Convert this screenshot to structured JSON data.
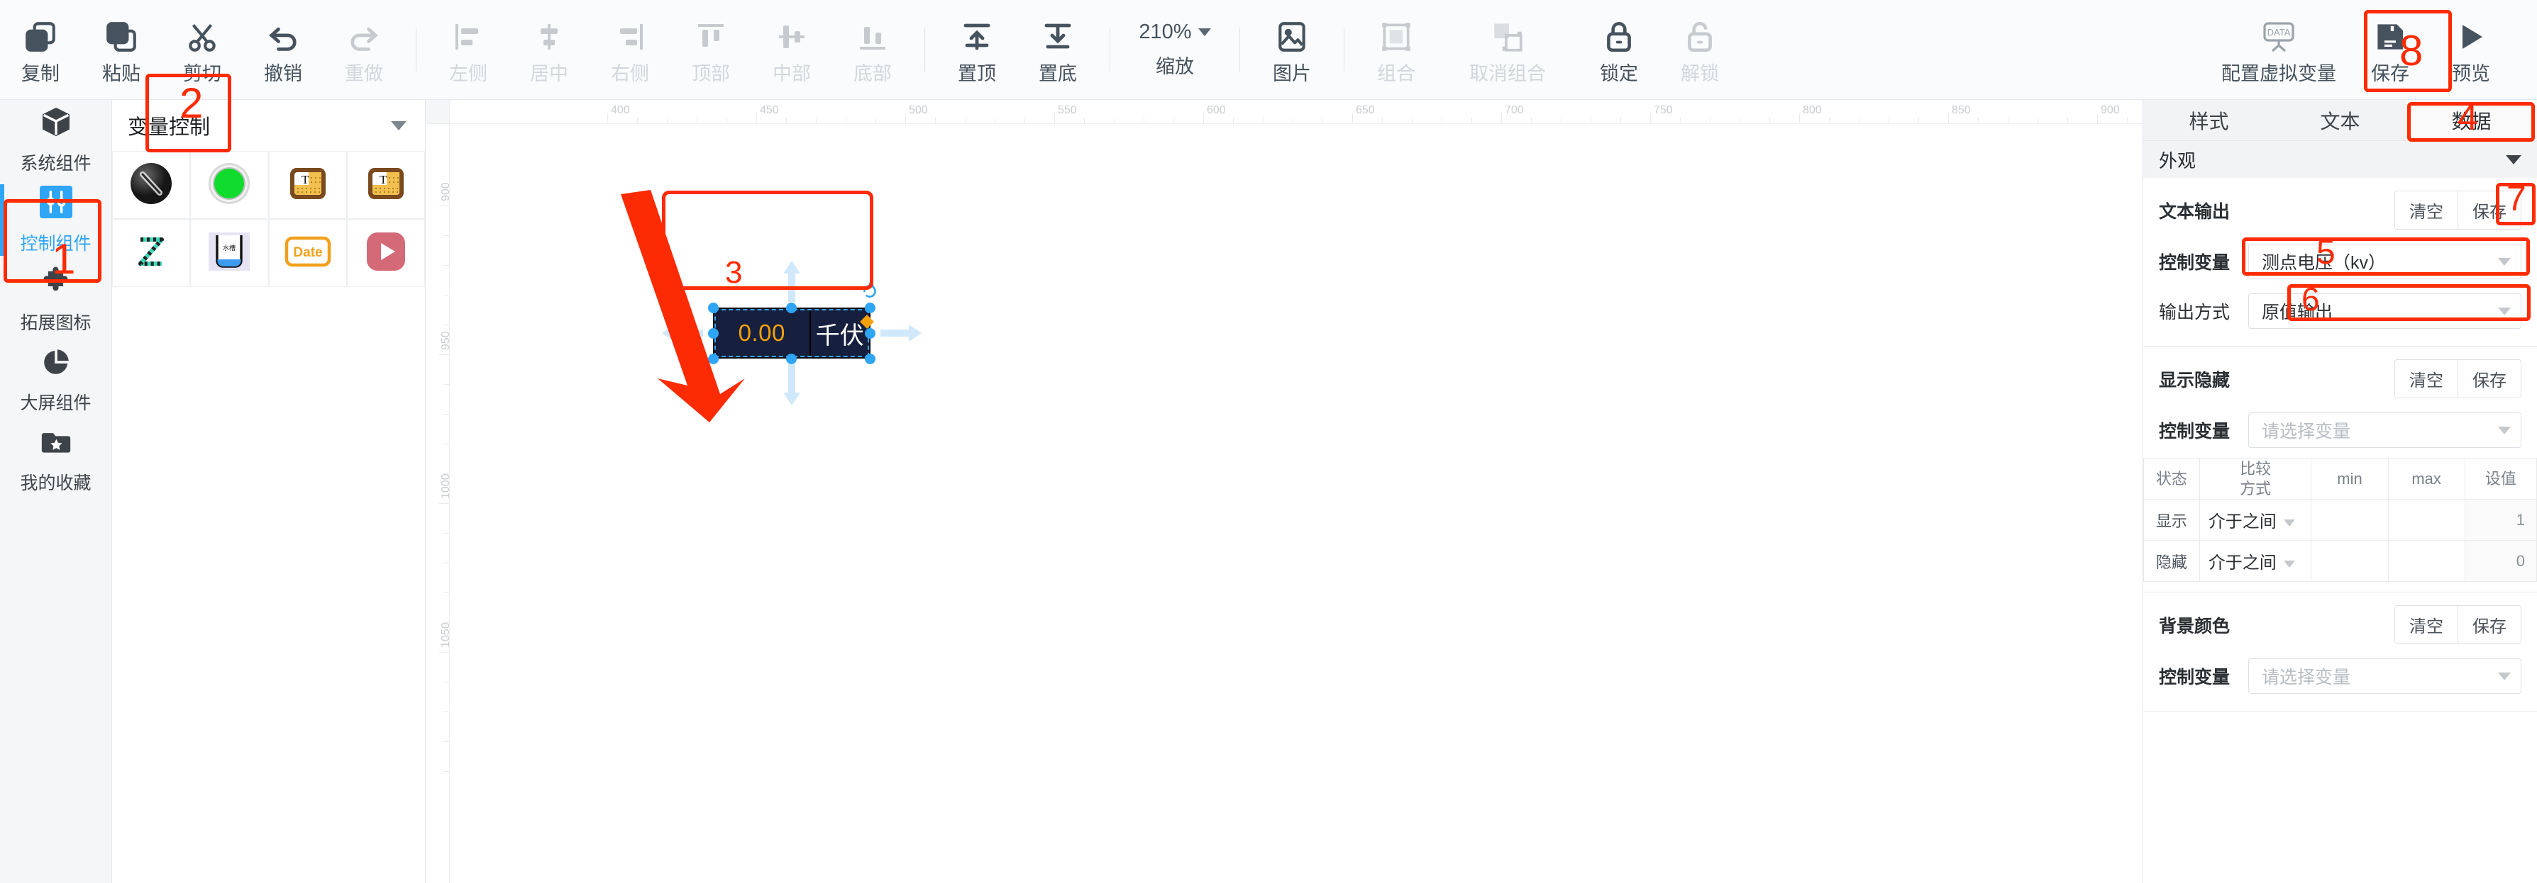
{
  "toolbar": {
    "groups": [
      {
        "items": [
          {
            "label": "复制",
            "icon": "copy-icon",
            "enabled": true
          },
          {
            "label": "粘贴",
            "icon": "paste-icon",
            "enabled": true
          },
          {
            "label": "剪切",
            "icon": "cut-icon",
            "enabled": true
          },
          {
            "label": "撤销",
            "icon": "undo-icon",
            "enabled": true
          },
          {
            "label": "重做",
            "icon": "redo-icon",
            "enabled": false
          }
        ]
      },
      {
        "items": [
          {
            "label": "左侧",
            "icon": "align-left-icon",
            "enabled": false
          },
          {
            "label": "居中",
            "icon": "align-center-icon",
            "enabled": false
          },
          {
            "label": "右侧",
            "icon": "align-right-icon",
            "enabled": false
          },
          {
            "label": "顶部",
            "icon": "align-top-icon",
            "enabled": false
          },
          {
            "label": "中部",
            "icon": "align-middle-icon",
            "enabled": false
          },
          {
            "label": "底部",
            "icon": "align-bottom-icon",
            "enabled": false
          }
        ]
      },
      {
        "items": [
          {
            "label": "置顶",
            "icon": "bring-to-front-icon",
            "enabled": true
          },
          {
            "label": "置底",
            "icon": "send-to-back-icon",
            "enabled": true
          }
        ]
      }
    ],
    "zoom": {
      "value": "210%",
      "label": "缩放"
    },
    "group_b": [
      {
        "label": "图片",
        "icon": "image-icon",
        "enabled": true
      },
      {
        "label": "组合",
        "icon": "group-icon",
        "enabled": false
      },
      {
        "label": "取消组合",
        "icon": "ungroup-icon",
        "enabled": false
      },
      {
        "label": "锁定",
        "icon": "lock-icon",
        "enabled": true
      },
      {
        "label": "解锁",
        "icon": "unlock-icon",
        "enabled": false
      }
    ],
    "group_c": [
      {
        "label": "配置虚拟变量",
        "icon": "data-board-icon",
        "enabled": true
      },
      {
        "label": "保存",
        "icon": "save-icon",
        "enabled": true
      },
      {
        "label": "预览",
        "icon": "play-icon",
        "enabled": true
      }
    ]
  },
  "rail": {
    "items": [
      {
        "label": "系统组件",
        "icon": "cube-icon",
        "active": false
      },
      {
        "label": "控制组件",
        "icon": "sliders-icon",
        "active": true
      },
      {
        "label": "拓展图标",
        "icon": "puzzle-icon",
        "active": false
      },
      {
        "label": "大屏组件",
        "icon": "pie-chart-icon",
        "active": false
      },
      {
        "label": "我的收藏",
        "icon": "folder-star-icon",
        "active": false
      }
    ]
  },
  "component_panel": {
    "title": "变量控制",
    "collapse_icon": "chevron-down-icon",
    "items": [
      {
        "name": "knob-component",
        "icon": "knob-icon"
      },
      {
        "name": "indicator-lamp-component",
        "icon": "green-lamp-icon"
      },
      {
        "name": "text-input-component",
        "icon": "text-box-icon"
      },
      {
        "name": "text-output-component",
        "icon": "text-box-2-icon"
      },
      {
        "name": "polyline-component",
        "icon": "zigzag-icon"
      },
      {
        "name": "tank-component",
        "icon": "tank-icon",
        "caption": "水槽"
      },
      {
        "name": "date-component",
        "icon": "date-icon",
        "caption": "Date"
      },
      {
        "name": "video-component",
        "icon": "play-button-icon"
      }
    ]
  },
  "canvas": {
    "ruler_h": [
      "400",
      "450",
      "500",
      "550",
      "600",
      "650",
      "700",
      "750",
      "800",
      "850",
      "900"
    ],
    "ruler_v": [
      "900",
      "950",
      "1000",
      "1050"
    ],
    "selected_widget": {
      "value": "0.00",
      "unit": "千伏",
      "value_color": "#f5a00c",
      "unit_color": "#ffffff",
      "background": "#16203e",
      "rotate_icon": "rotate-handle-icon",
      "skew_icon": "skew-handle-icon"
    }
  },
  "right_panel": {
    "tabs": [
      {
        "label": "样式",
        "active": false
      },
      {
        "label": "文本",
        "active": false
      },
      {
        "label": "数据",
        "active": true
      }
    ],
    "appearance": {
      "title": "外观",
      "collapse_icon": "chevron-down-icon"
    },
    "blocks": [
      {
        "title": "文本输出",
        "clear_label": "清空",
        "save_label": "保存",
        "fields": [
          {
            "label": "控制变量",
            "value": "测点电压（kv）",
            "placeholder": "请选择变量",
            "is_placeholder": false
          },
          {
            "label": "输出方式",
            "value": "原值输出",
            "placeholder": "请选择",
            "is_placeholder": false
          }
        ]
      },
      {
        "title": "显示隐藏",
        "clear_label": "清空",
        "save_label": "保存",
        "fields": [
          {
            "label": "控制变量",
            "value": "请选择变量",
            "placeholder": "请选择变量",
            "is_placeholder": true
          }
        ],
        "table": {
          "headers": [
            "状态",
            "比较\n方式",
            "min",
            "max",
            "设值"
          ],
          "rows": [
            {
              "state": "显示",
              "compare": "介于之间",
              "min": "",
              "max": "",
              "setv": "1"
            },
            {
              "state": "隐藏",
              "compare": "介于之间",
              "min": "",
              "max": "",
              "setv": "0"
            }
          ]
        }
      },
      {
        "title": "背景颜色",
        "clear_label": "清空",
        "save_label": "保存",
        "fields": [
          {
            "label": "控制变量",
            "value": "请选择变量",
            "placeholder": "请选择变量",
            "is_placeholder": true
          }
        ]
      }
    ]
  },
  "annotations": {
    "markers": [
      "1",
      "2",
      "3",
      "4",
      "5",
      "6",
      "7",
      "8"
    ],
    "color": "#fc2b04"
  }
}
